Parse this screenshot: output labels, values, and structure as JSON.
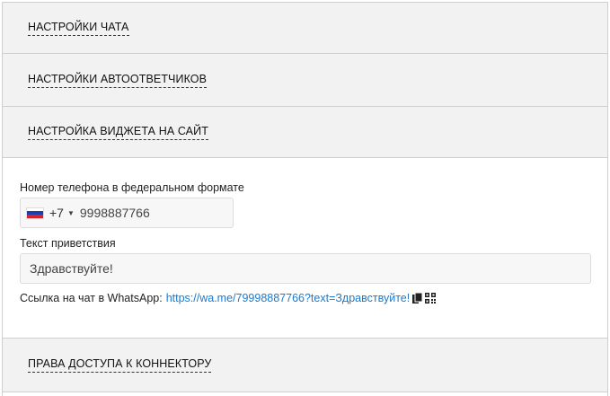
{
  "sections": {
    "chat_settings": {
      "title": "НАСТРОЙКИ ЧАТА"
    },
    "autoresponders": {
      "title": "НАСТРОЙКИ АВТООТВЕТЧИКОВ"
    },
    "widget": {
      "title": "НАСТРОЙКА ВИДЖЕТА НА САЙТ",
      "phone_label": "Номер телефона в федеральном формате",
      "dial_code": "+7",
      "phone_value": "9998887766",
      "greeting_label": "Текст приветствия",
      "greeting_value": "Здравствуйте!",
      "link_label": "Ссылка на чат в WhatsApp:",
      "link_url": "https://wa.me/79998887766?text=Здравствуйте!"
    },
    "access_rights": {
      "title": "ПРАВА ДОСТУПА К КОННЕКТОРУ"
    }
  },
  "colors": {
    "header_bg": "#f2f2f2",
    "link": "#1a7bd0",
    "flag": [
      "#ffffff",
      "#1c3fb0",
      "#d8232a"
    ]
  },
  "icons": [
    "copy-icon",
    "qr-code-icon",
    "caret-down-icon",
    "russia-flag-icon"
  ]
}
